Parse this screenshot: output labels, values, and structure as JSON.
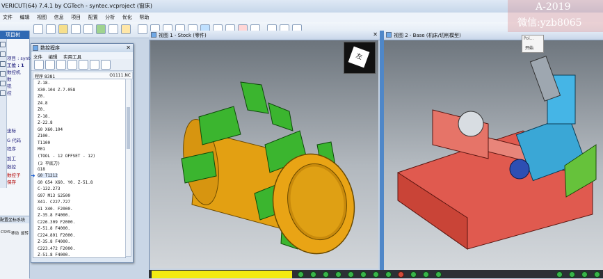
{
  "window": {
    "title": "VERICUT(64) 7.4.1 by CGTech - syntec.vcproject (窗床)"
  },
  "menu": [
    "文件",
    "编辑",
    "视图",
    "信息",
    "项目",
    "配置",
    "分析",
    "优化",
    "帮助"
  ],
  "project_panel": {
    "title": "项目树",
    "tree": [
      {
        "label": "项目 : syntec"
      },
      {
        "label": "工位 : 1"
      },
      {
        "label": "数控机"
      },
      {
        "label": "数"
      },
      {
        "label": "铣"
      },
      {
        "label": "控"
      },
      {
        "label": "坐标"
      },
      {
        "label": "G 代码"
      },
      {
        "label": "程序"
      },
      {
        "label": "加工"
      },
      {
        "label": "数控"
      },
      {
        "label": "数控子"
      },
      {
        "label": "保存"
      }
    ],
    "bottom_title": "配置坐标系统",
    "bottom_tabs": [
      "CSYS",
      "移动",
      "旋转"
    ]
  },
  "nc_window": {
    "title": "数控程序",
    "menu": [
      "文件",
      "编辑",
      "实用工具"
    ],
    "file_label": "程序 8381",
    "file_name": "O1111.NC",
    "lines": [
      "Z-18.",
      "X30.104 Z-7.058",
      "Z0.",
      "Z4.8",
      "Z0.",
      "Z-18.",
      "Z-22.8",
      "G0 X60.104",
      "Z100.",
      "T1100",
      "M01",
      "(TOOL - 12 OFFSET - 12)",
      "(3 平底刀)",
      "G18",
      "G0 T1212",
      "G0 G54 X60. Y0. Z-51.8",
      "C-132.273",
      "G97 M13 S2500",
      "X41. C227.727",
      "G1 X40. F2000.",
      "Z-35.8 F4000.",
      "C226.309 F2000.",
      "Z-51.8 F4000.",
      "C224.891 F2000.",
      "Z-35.8 F4000.",
      "C223.472 F2000.",
      "Z-51.8 F4000."
    ],
    "current_line_index": 14
  },
  "viewport1": {
    "title": "视图 1 - Stock (零件)"
  },
  "viewport2": {
    "title": "视图 2 - Base (机床/切削模型)"
  },
  "cube_label": "左",
  "popup": {
    "label1": "Poi...",
    "label2": "开始"
  },
  "watermark": {
    "line1": "A-2019",
    "line2": "微信:yzb8065"
  },
  "colors": {
    "part_green": "#3bb52f",
    "part_orange": "#e9a415",
    "machine_red": "#e05a4f",
    "machine_blue": "#3aa7d6",
    "status_yellow": "#f3ea12",
    "status_green": "#39b34a"
  },
  "progress": {
    "fraction": 0.31
  }
}
